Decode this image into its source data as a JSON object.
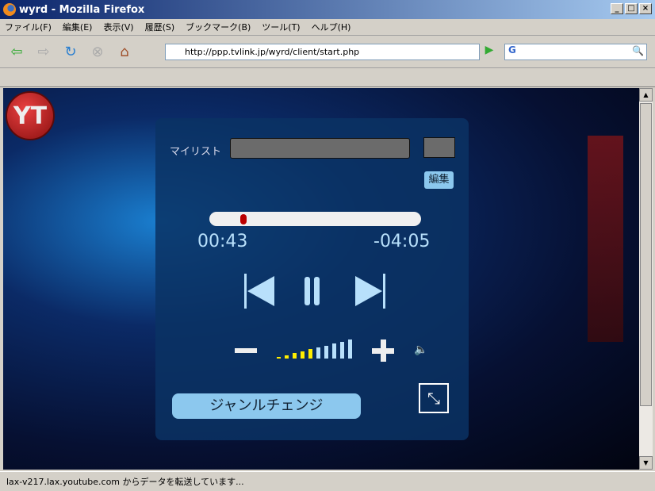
{
  "window": {
    "title": "wyrd - Mozilla Firefox"
  },
  "menu": [
    "ファイル(F)",
    "編集(E)",
    "表示(V)",
    "履歴(S)",
    "ブックマーク(B)",
    "ツール(T)",
    "ヘルプ(H)"
  ],
  "toolbar": {
    "url": "http://ppp.tvlink.jp/wyrd/client/start.php",
    "search_engine": "G",
    "search_value": ""
  },
  "player": {
    "logo": "YT",
    "mylist_label": "マイリスト",
    "edit_label": "編集",
    "elapsed": "00:43",
    "remaining": "-04:05",
    "progress_fraction": 0.15,
    "volume_level": 5,
    "volume_max": 10,
    "genre_change_label": "ジャンルチェンジ"
  },
  "status": {
    "text": "lax-v217.lax.youtube.com からデータを転送しています..."
  }
}
